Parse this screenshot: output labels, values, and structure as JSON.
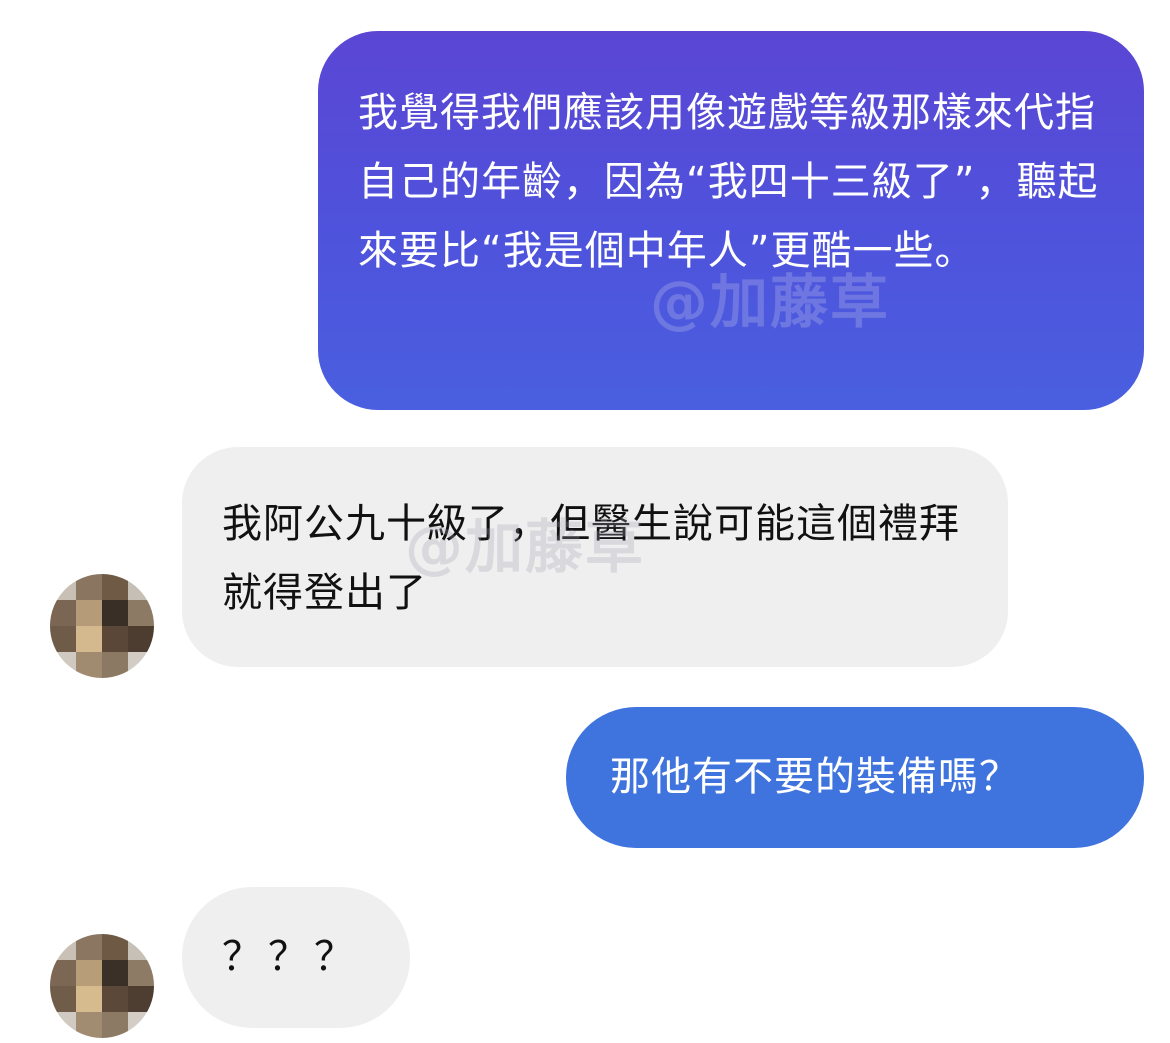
{
  "conversation": {
    "messages": [
      {
        "direction": "sent",
        "text": "我覺得我們應該用像遊戲等級那樣來代指自己的年齡，因為“我四十三級了”，聽起來要比“我是個中年人”更酷一些。"
      },
      {
        "direction": "received",
        "text": "我阿公九十級了，但醫生說可能這個禮拜就得登出了"
      },
      {
        "direction": "sent",
        "text": "那他有不要的裝備嗎？"
      },
      {
        "direction": "received",
        "text": "？？？"
      }
    ]
  },
  "watermark": {
    "text": "@加藤草"
  },
  "colors": {
    "sent_gradient_top": "#5b46d4",
    "sent_gradient_bottom": "#4a5fe0",
    "sent_solid": "#3f73dd",
    "received_bg": "#efefef"
  },
  "icons": {
    "avatar": "pixelated-avatar-icon"
  }
}
